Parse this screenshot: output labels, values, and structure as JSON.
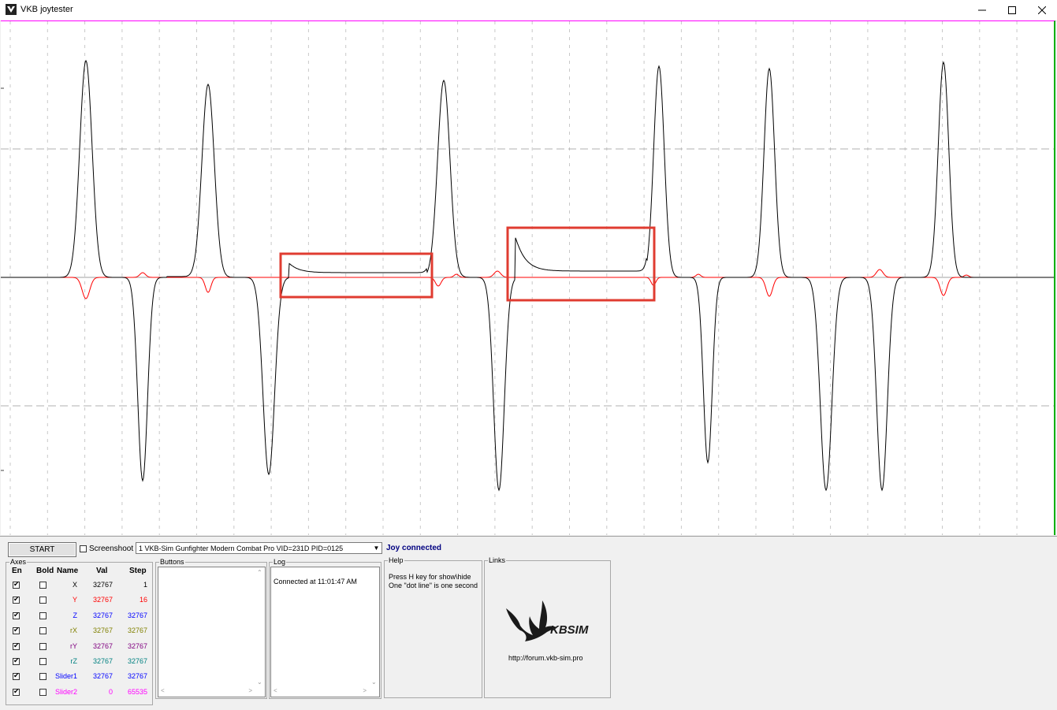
{
  "window": {
    "title": "VKB joytester",
    "icons": [
      "app-logo-icon",
      "minimize-icon",
      "maximize-icon",
      "close-icon"
    ]
  },
  "toolbar": {
    "start_label": "START",
    "screenshot_label": "Screenshoot",
    "screenshot_checked": false,
    "device_selected": "1  VKB-Sim Gunfighter Modern Combat Pro  VID=231D PID=0125",
    "status": "Joy connected"
  },
  "axes": {
    "title": "Axes",
    "headers": {
      "en": "En",
      "bold": "Bold",
      "name": "Name",
      "val": "Val",
      "step": "Step"
    },
    "rows": [
      {
        "name": "X",
        "val": "32767",
        "step": "1",
        "en": true,
        "bold": false,
        "color": "#000000"
      },
      {
        "name": "Y",
        "val": "32767",
        "step": "16",
        "en": true,
        "bold": false,
        "color": "#ff0000"
      },
      {
        "name": "Z",
        "val": "32767",
        "step": "32767",
        "en": true,
        "bold": false,
        "color": "#0000ff"
      },
      {
        "name": "rX",
        "val": "32767",
        "step": "32767",
        "en": true,
        "bold": false,
        "color": "#808000"
      },
      {
        "name": "rY",
        "val": "32767",
        "step": "32767",
        "en": true,
        "bold": false,
        "color": "#800080"
      },
      {
        "name": "rZ",
        "val": "32767",
        "step": "32767",
        "en": true,
        "bold": false,
        "color": "#008080"
      },
      {
        "name": "Slider1",
        "val": "32767",
        "step": "32767",
        "en": true,
        "bold": false,
        "color": "#0000ff"
      },
      {
        "name": "Slider2",
        "val": "0",
        "step": "65535",
        "en": true,
        "bold": false,
        "color": "#ff00ff"
      }
    ]
  },
  "buttons_box": {
    "title": "Buttons"
  },
  "log": {
    "title": "Log",
    "entries": [
      "Connected at 11:01:47 AM"
    ]
  },
  "help": {
    "title": "Help",
    "lines": [
      "Press H key for show\\hide",
      "One \"dot line\" is one second"
    ]
  },
  "links": {
    "title": "Links",
    "brand": "KBSIM",
    "url": "http://forum.vkb-sim.pro"
  },
  "colors": {
    "trace_x": "#000000",
    "trace_y": "#ff0000",
    "highlight_box": "#e03c31",
    "grid_dash": "#b0b0b0"
  }
}
